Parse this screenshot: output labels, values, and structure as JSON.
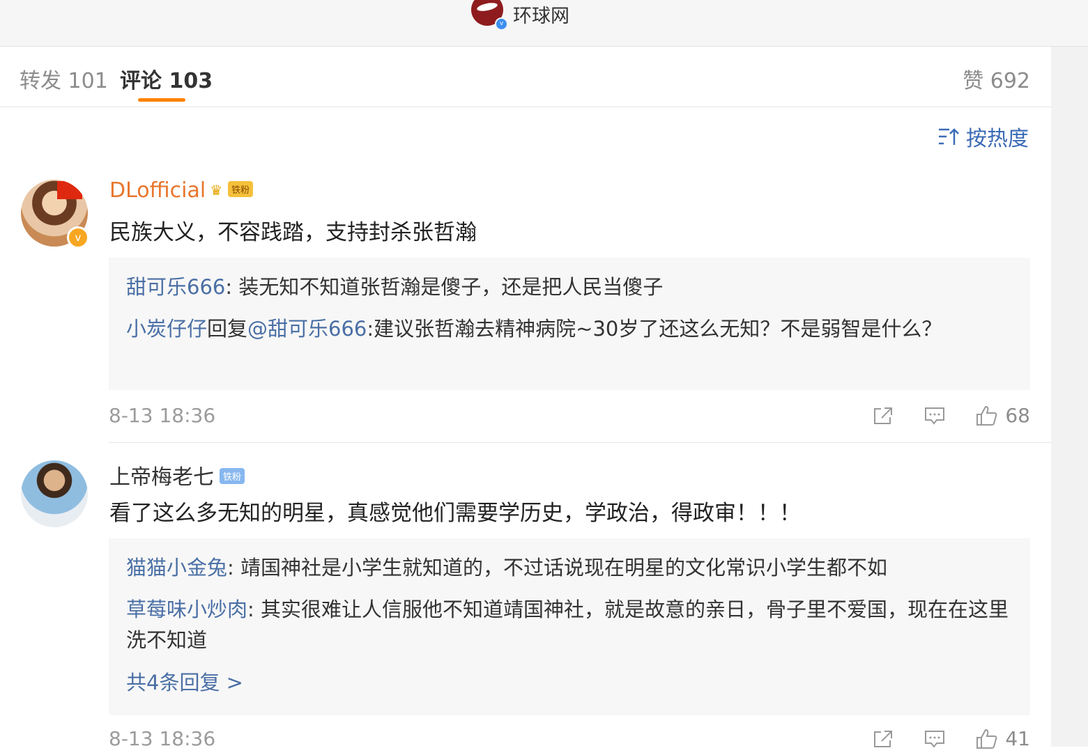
{
  "header": {
    "account_name": "环球网"
  },
  "tabs": {
    "repost": "转发 101",
    "comment": "评论 103",
    "likes": "赞 692"
  },
  "sort": {
    "label": "按热度"
  },
  "comments": [
    {
      "username": "DLofficial",
      "badge": "铁粉",
      "text": "民族大义，不容践踏，支持封杀张哲瀚",
      "replies": [
        {
          "name": "甜可乐666",
          "mid": "",
          "target": "",
          "text": ": 装无知不知道张哲瀚是傻子，还是把人民当傻子"
        },
        {
          "name": "小炭仔仔",
          "mid": "回复",
          "target": "@甜可乐666",
          "text": ":建议张哲瀚去精神病院~30岁了还这么无知？不是弱智是什么？"
        }
      ],
      "time": "8-13 18:36",
      "like_count": "68"
    },
    {
      "username": "上帝梅老七",
      "badge": "铁粉",
      "text": "看了这么多无知的明星，真感觉他们需要学历史，学政治，得政审！！！",
      "replies": [
        {
          "name": "猫猫小金兔",
          "text": ": 靖国神社是小学生就知道的，不过话说现在明星的文化常识小学生都不如"
        },
        {
          "name": "草莓味小炒肉",
          "text": ": 其实很难让人信服他不知道靖国神社，就是故意的亲日，骨子里不爱国，现在在这里洗不知道"
        }
      ],
      "more_replies": "共4条回复 >",
      "time": "8-13 18:36",
      "like_count": "41"
    }
  ],
  "colors": {
    "accent": "#ff8200",
    "link": "#4a6fa5",
    "username_highlight": "#e8762d"
  }
}
